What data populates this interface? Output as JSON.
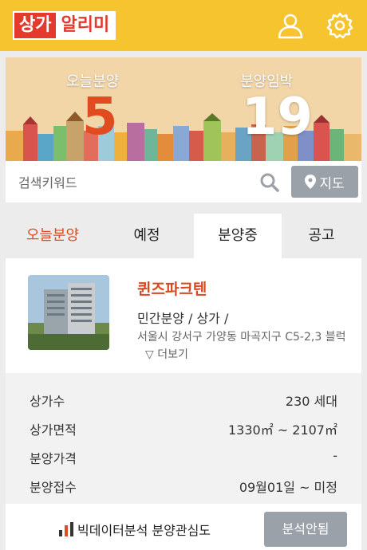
{
  "header": {
    "logo_part1": "상가",
    "logo_part2": "알리미",
    "user_icon": "user-icon",
    "settings_icon": "gear-icon",
    "brand_color": "#f6c42f",
    "logo_red": "#e33a2d"
  },
  "hero": {
    "today_label": "오늘분양",
    "today_count": "5",
    "imminent_label": "분양임박",
    "imminent_count": "19",
    "today_count_color": "#e04b1f"
  },
  "search": {
    "placeholder": "검색키워드",
    "search_icon": "search-icon",
    "map_label": "지도",
    "map_icon": "map-pin-icon"
  },
  "tabs": [
    {
      "label": "오늘분양"
    },
    {
      "label": "예정"
    },
    {
      "label": "분양중"
    },
    {
      "label": "공고"
    }
  ],
  "listing": {
    "title": "퀸즈파크텐",
    "type": "민간분양 / 상가 /",
    "address": "서울시 강서구 가양동 마곡지구 C5-2,3 블럭",
    "more": "▽ 더보기",
    "rows": [
      {
        "label": "상가수",
        "value": "230 세대"
      },
      {
        "label": "상가면적",
        "value": "1330㎡ ~ 2107㎡"
      },
      {
        "label": "분양가격",
        "value": "-"
      },
      {
        "label": "분양접수",
        "value": "09월01일 ~ 미정"
      }
    ],
    "bigdata_label": "빅데이터분석 분양관심도",
    "bigdata_icon": "bar-chart-icon",
    "analysis_button": "분석안됨"
  }
}
